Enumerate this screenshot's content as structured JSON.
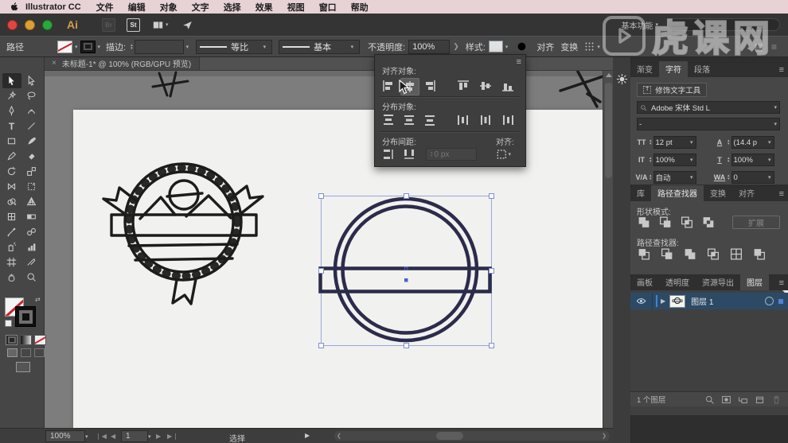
{
  "colors": {
    "accent_blue": "#3a7bd5",
    "selection_blue": "#8aa0e0",
    "artwork_navy": "#2b2b4a",
    "sketch_black": "#1c1c1c",
    "menubar_pink": "#e7d2d6",
    "watermark_white": "rgba(255,255,255,0.45)",
    "layer_row_blue": "#2c4a66"
  },
  "menubar": {
    "app": "Illustrator CC",
    "items": [
      "文件",
      "编辑",
      "对象",
      "文字",
      "选择",
      "效果",
      "视图",
      "窗口",
      "帮助"
    ]
  },
  "appbar": {
    "ai": "Ai",
    "br": "Br",
    "st": "St",
    "workspace": "基本功能"
  },
  "controlbar": {
    "target": "路径",
    "stroke": "描边:",
    "profile": "等比",
    "brush": "基本",
    "opacity_label": "不透明度:",
    "opacity": "100%",
    "style": "样式:",
    "align": "对齐",
    "transform": "变换"
  },
  "doc_tab": {
    "close": "×",
    "title": "未标题-1* @ 100% (RGB/GPU 预览)"
  },
  "align_panel": {
    "align_objects": "对齐对象:",
    "distribute_objects": "分布对象:",
    "distribute_spacing": "分布间距:",
    "align_to": "对齐:",
    "spacing": "0 px"
  },
  "char_panel": {
    "tab_gradient": "渐变",
    "tab_character": "字符",
    "tab_paragraph": "段落",
    "touch_type": "修饰文字工具",
    "font": "Adobe 宋体 Std L",
    "font_style": "-",
    "size": "12 pt",
    "leading": "(14.4 p",
    "v_scale": "100%",
    "h_scale": "100%",
    "kerning": "自动",
    "tracking": "0",
    "icon_size": "TT",
    "icon_leading": "A",
    "icon_vscale": "IT",
    "icon_hscale": "T",
    "icon_kern": "V/A",
    "icon_track": "WA"
  },
  "pathfinder": {
    "tab_library": "库",
    "tab_pathfinder": "路径查找器",
    "tab_transform": "变换",
    "tab_align": "对齐",
    "shape_modes": "形状模式:",
    "expand": "扩展",
    "pathfinders": "路径查找器:"
  },
  "layers": {
    "tab_artboards": "画板",
    "tab_transparency": "透明度",
    "tab_export": "资源导出",
    "tab_layers": "图层",
    "layer1": "图层 1",
    "count": "1 个图层"
  },
  "statusbar": {
    "zoom": "100%",
    "artboard": "1",
    "status": "选择"
  },
  "watermark": {
    "text": "虎课网"
  }
}
